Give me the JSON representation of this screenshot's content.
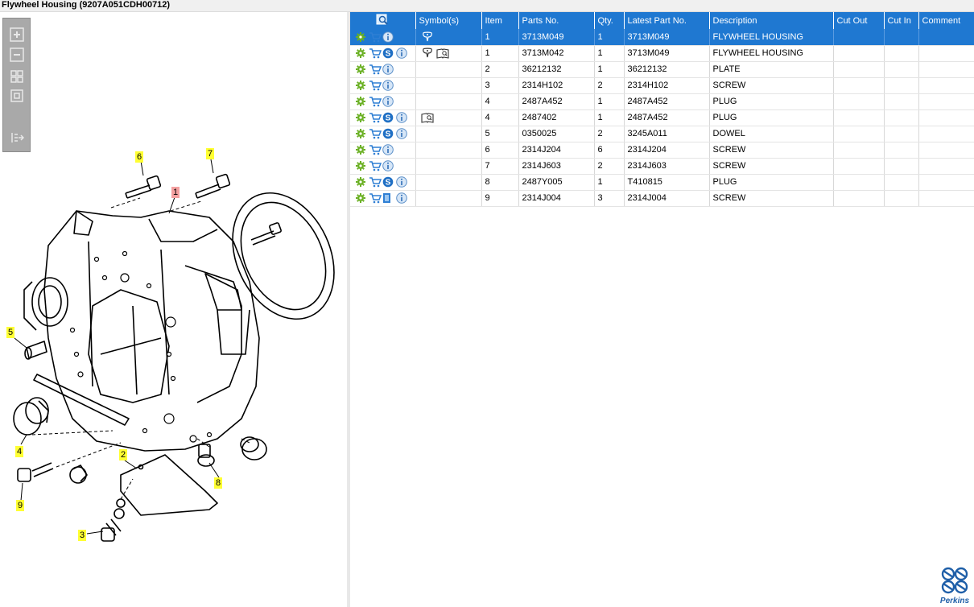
{
  "window": {
    "title": "Flywheel Housing (9207A051CDH00712)"
  },
  "toolbar": {
    "buttons": [
      {
        "name": "zoom-in-button",
        "icon": "zoom-in-icon"
      },
      {
        "name": "zoom-out-button",
        "icon": "zoom-out-icon"
      },
      {
        "name": "fit-all-button",
        "icon": "fit-all-icon"
      },
      {
        "name": "fit-window-button",
        "icon": "fit-window-icon"
      },
      {
        "name": "export-button",
        "icon": "export-icon"
      }
    ]
  },
  "drawing": {
    "callouts": [
      "6",
      "7",
      "1",
      "5",
      "4",
      "2",
      "8",
      "9",
      "3"
    ]
  },
  "table": {
    "headers": {
      "icons": "",
      "symbols": "Symbol(s)",
      "item": "Item",
      "part_no": "Parts No.",
      "qty": "Qty.",
      "latest": "Latest Part No.",
      "description": "Description",
      "cut_out": "Cut Out",
      "cut_in": "Cut In",
      "comment": "Comment"
    },
    "rows": [
      {
        "item": "1",
        "part_no": "3713M049",
        "qty": "1",
        "latest": "3713M049",
        "description": "FLYWHEEL HOUSING",
        "s": false,
        "symbols": [
          "balloon"
        ],
        "selected": true
      },
      {
        "item": "1",
        "part_no": "3713M042",
        "qty": "1",
        "latest": "3713M049",
        "description": "FLYWHEEL HOUSING",
        "s": true,
        "symbols": [
          "balloon",
          "book"
        ],
        "selected": false
      },
      {
        "item": "2",
        "part_no": "36212132",
        "qty": "1",
        "latest": "36212132",
        "description": "PLATE",
        "s": false,
        "symbols": [],
        "selected": false
      },
      {
        "item": "3",
        "part_no": "2314H102",
        "qty": "2",
        "latest": "2314H102",
        "description": "SCREW",
        "s": false,
        "symbols": [],
        "selected": false
      },
      {
        "item": "4",
        "part_no": "2487A452",
        "qty": "1",
        "latest": "2487A452",
        "description": "PLUG",
        "s": false,
        "symbols": [],
        "selected": false
      },
      {
        "item": "4",
        "part_no": "2487402",
        "qty": "1",
        "latest": "2487A452",
        "description": "PLUG",
        "s": true,
        "symbols": [
          "book"
        ],
        "selected": false
      },
      {
        "item": "5",
        "part_no": "0350025",
        "qty": "2",
        "latest": "3245A011",
        "description": "DOWEL",
        "s": true,
        "symbols": [],
        "selected": false
      },
      {
        "item": "6",
        "part_no": "2314J204",
        "qty": "6",
        "latest": "2314J204",
        "description": "SCREW",
        "s": false,
        "symbols": [],
        "selected": false
      },
      {
        "item": "7",
        "part_no": "2314J603",
        "qty": "2",
        "latest": "2314J603",
        "description": "SCREW",
        "s": false,
        "symbols": [],
        "selected": false
      },
      {
        "item": "8",
        "part_no": "2487Y005",
        "qty": "1",
        "latest": "T410815",
        "description": "PLUG",
        "s": true,
        "symbols": [],
        "selected": false
      },
      {
        "item": "9",
        "part_no": "2314J004",
        "qty": "3",
        "latest": "2314J004",
        "description": "SCREW",
        "s": false,
        "symbols": [],
        "selected": false,
        "doc": true
      }
    ]
  },
  "logo": {
    "text": "Perkins"
  },
  "colors": {
    "accent": "#1f78d1",
    "callout": "#ffff33",
    "callout_selected": "#f4a0a0",
    "gear": "#6ab023"
  }
}
